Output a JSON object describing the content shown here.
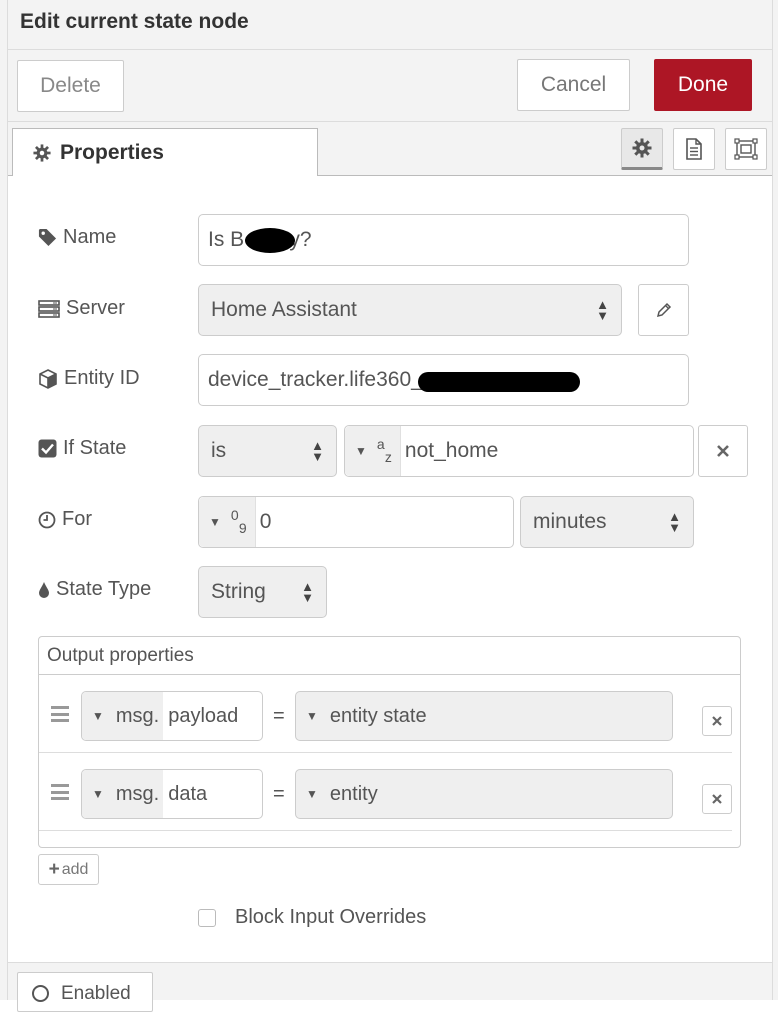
{
  "dialog": {
    "title": "Edit current state node",
    "delete_label": "Delete",
    "cancel_label": "Cancel",
    "done_label": "Done",
    "accent_color": "#ad1625"
  },
  "tabs": {
    "active_label": "Properties",
    "icons": [
      "gear-icon",
      "description-icon",
      "appearance-icon"
    ]
  },
  "form": {
    "name": {
      "label": "Name",
      "value": "Is B Away?"
    },
    "server": {
      "label": "Server",
      "value": "Home Assistant"
    },
    "entity_id": {
      "label": "Entity ID",
      "value": "device_tracker.life360_"
    },
    "if_state": {
      "label": "If State",
      "operator": "is",
      "type_symbol_top": "a",
      "type_symbol_bottom": "z",
      "value": "not_home"
    },
    "for": {
      "label": "For",
      "type_symbol_top": "0",
      "type_symbol_bottom": "9",
      "value": "0",
      "unit": "minutes"
    },
    "state_type": {
      "label": "State Type",
      "value": "String"
    }
  },
  "output": {
    "title": "Output properties",
    "rows": [
      {
        "prefix": "msg.",
        "property": "payload",
        "equals": "=",
        "value": "entity state"
      },
      {
        "prefix": "msg.",
        "property": "data",
        "equals": "=",
        "value": "entity"
      }
    ],
    "add_label": "add"
  },
  "block_input_overrides": {
    "label": "Block Input Overrides",
    "checked": false
  },
  "footer": {
    "enabled_label": "Enabled"
  }
}
